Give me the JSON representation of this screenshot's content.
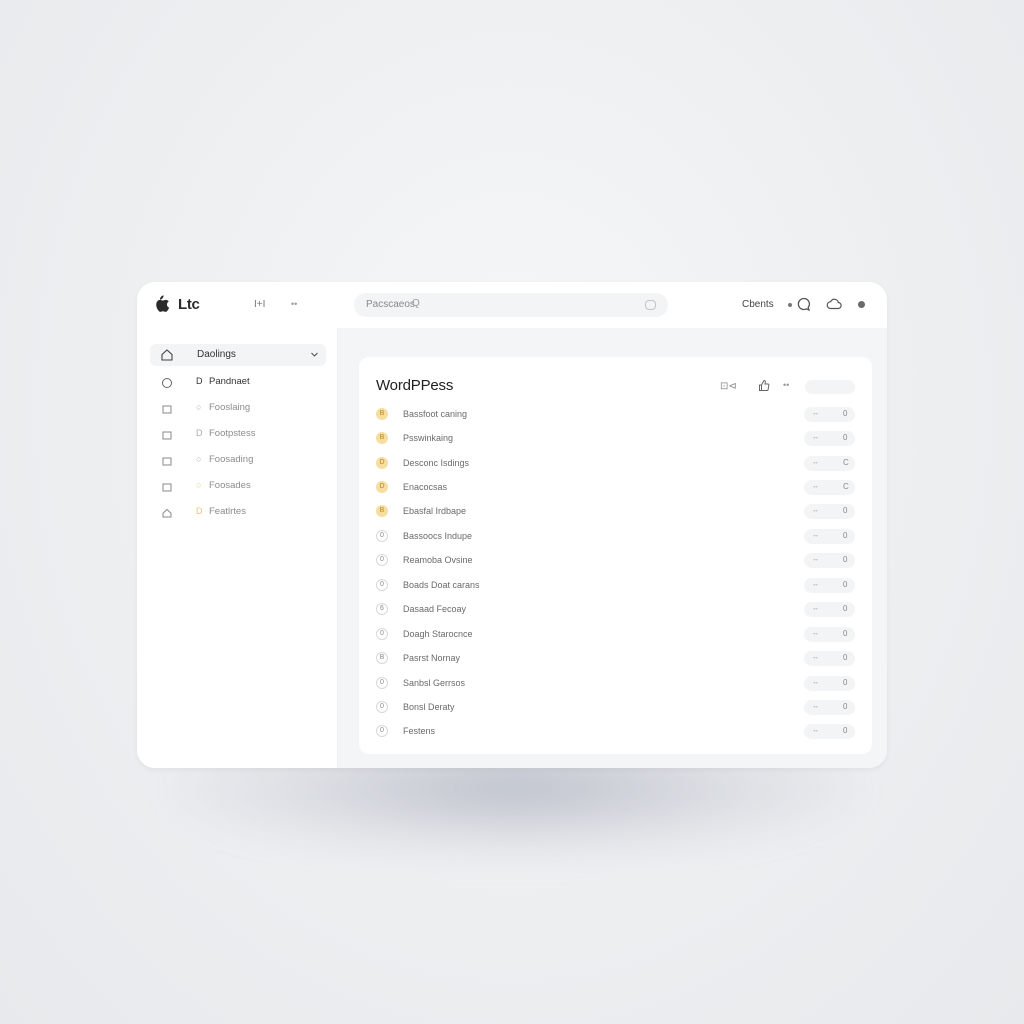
{
  "topbar": {
    "brand": "Ltc",
    "nav": [
      "I+I",
      "••"
    ],
    "search": {
      "text": "Pacscaeos",
      "glyph": "Q"
    },
    "clients_label": "Cbents"
  },
  "sidebar": {
    "header": {
      "label": "Daolings"
    },
    "items": [
      {
        "mark": "D",
        "label": "Pandnaet"
      },
      {
        "mark": "○",
        "label": "Fooslaing"
      },
      {
        "mark": "D",
        "label": "Footpstess"
      },
      {
        "mark": "○",
        "label": "Foosading"
      },
      {
        "mark": "○",
        "label": "Foosades"
      },
      {
        "mark": "D",
        "label": "Featlrtes"
      }
    ]
  },
  "card": {
    "title": "WordPPess",
    "header_icons": {
      "left": "⊡⊲",
      "mid": "••"
    },
    "rows": [
      {
        "icon": "B",
        "label": "Bassfoot caning",
        "pill_a": "↔",
        "pill_b": "0"
      },
      {
        "icon": "B",
        "label": "Psswinkaing",
        "pill_a": "↔",
        "pill_b": "0"
      },
      {
        "icon": "D",
        "label": "Desconc Isdings",
        "pill_a": "↔",
        "pill_b": "C"
      },
      {
        "icon": "D",
        "label": "Enacocsas",
        "pill_a": "↔",
        "pill_b": "C"
      },
      {
        "icon": "B",
        "label": "Ebasfal Irdbape",
        "pill_a": "↔",
        "pill_b": "0"
      },
      {
        "icon": "0",
        "label": "Bassoocs Indupe",
        "pill_a": "↔",
        "pill_b": "0"
      },
      {
        "icon": "0",
        "label": "Reamoba Ovsine",
        "pill_a": "↔",
        "pill_b": "0"
      },
      {
        "icon": "0",
        "label": "Boads Doat carans",
        "pill_a": "↔",
        "pill_b": "0"
      },
      {
        "icon": "6",
        "label": "Dasaad Fecoay",
        "pill_a": "↔",
        "pill_b": "0"
      },
      {
        "icon": "0",
        "label": "Doagh Starocnce",
        "pill_a": "↔",
        "pill_b": "0"
      },
      {
        "icon": "B",
        "label": "Pasrst Nornay",
        "pill_a": "↔",
        "pill_b": "0"
      },
      {
        "icon": "0",
        "label": "Sanbsl Gerrsos",
        "pill_a": "↔",
        "pill_b": "0"
      },
      {
        "icon": "0",
        "label": "Bonsl Deraty",
        "pill_a": "↔",
        "pill_b": "0"
      },
      {
        "icon": "0",
        "label": "Festens",
        "pill_a": "↔",
        "pill_b": "0"
      }
    ]
  },
  "colors": {
    "accent_yellow": "#f7dea0",
    "panel_bg": "#f4f5f6",
    "page_bg": "#eceef0"
  },
  "icons": [
    "apple-logo-icon",
    "search-end-icon",
    "chat-bubble-icon",
    "cloud-icon",
    "home-icon",
    "chevron-down-icon",
    "bookmark-icon",
    "thumbs-up-icon"
  ]
}
